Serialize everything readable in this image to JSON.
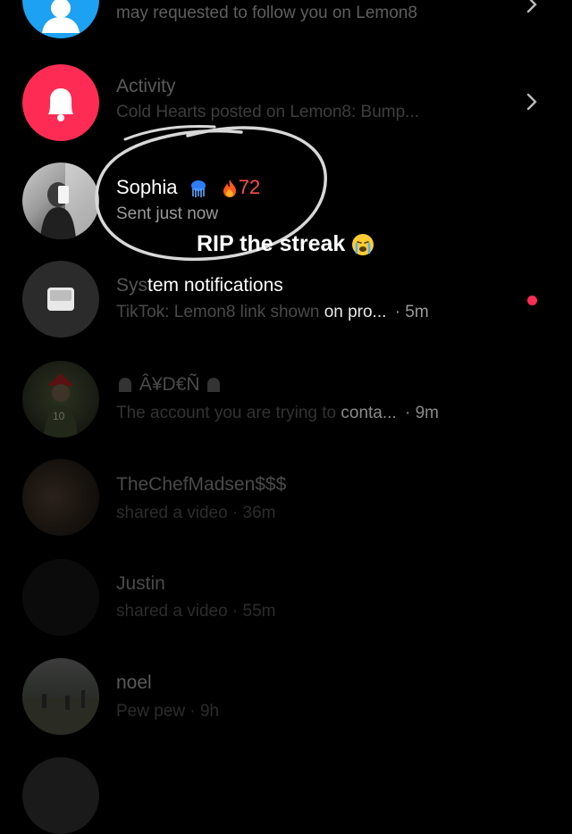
{
  "rows": [
    {
      "sub": "may requested to follow you on Lemon8"
    },
    {
      "title": "Activity",
      "sub": "Cold Hearts posted on Lemon8: Bump..."
    },
    {
      "title": "Sophia",
      "streak": "72",
      "sub": "Sent just now"
    },
    {
      "title_dim": "Sys",
      "title_bright": "tem notifications",
      "sub_dim": "TikTok: Lemon8 link shown ",
      "sub_bright": "on pro...",
      "time": "· 5m"
    },
    {
      "title": "Â¥D€Ñ",
      "sub_dim": "The account you are trying to ",
      "sub_bright": "conta...",
      "time": "· 9m"
    },
    {
      "title": "TheChefMadsen$$$",
      "sub": "shared a video · 36m"
    },
    {
      "title": "Justin",
      "sub": "shared a video · 55m"
    },
    {
      "title": "noel",
      "sub": "Pew pew · 9h"
    }
  ],
  "overlay": {
    "caption": "RIP the streak"
  },
  "colors": {
    "activity_bg": "#fe2c55",
    "top_icon_bg": "#1da1f2",
    "unread_dot": "#fe2c55",
    "streak": "#ff4d4d"
  }
}
